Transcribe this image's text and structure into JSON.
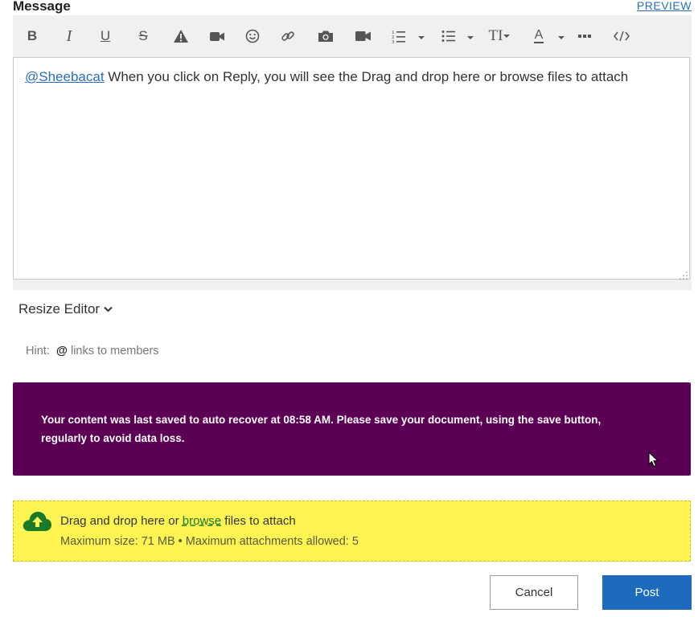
{
  "header": {
    "title": "Message",
    "preview_label": "PREVIEW"
  },
  "toolbar": {
    "buttons": [
      {
        "name": "bold",
        "glyph": "B"
      },
      {
        "name": "italic",
        "glyph": "I"
      },
      {
        "name": "underline",
        "glyph": "U"
      },
      {
        "name": "strikethrough",
        "glyph": "S"
      },
      {
        "name": "spoiler",
        "icon": "warning-icon"
      },
      {
        "name": "video",
        "icon": "video-icon"
      },
      {
        "name": "emoji",
        "icon": "smiley-icon"
      },
      {
        "name": "link",
        "icon": "link-icon"
      },
      {
        "name": "photo",
        "icon": "camera-icon"
      },
      {
        "name": "video-embed",
        "icon": "video-icon"
      },
      {
        "name": "numbered-list",
        "icon": "ordered-list-icon"
      },
      {
        "name": "bulleted-list",
        "icon": "bullet-list-icon"
      },
      {
        "name": "font-size",
        "glyph": "TI"
      },
      {
        "name": "font-color",
        "glyph": "A"
      },
      {
        "name": "more",
        "icon": "more-icon"
      },
      {
        "name": "source-code",
        "icon": "code-icon"
      }
    ]
  },
  "editor": {
    "mention": "@Sheebacat",
    "body": " When you click on Reply, you will see the Drag and drop here or browse files to attach"
  },
  "resize_editor_label": "Resize Editor",
  "hint": {
    "label": "Hint:",
    "symbol": "@",
    "text": "links to members"
  },
  "autosave_banner": {
    "text": "Your content was last saved to auto recover at 08:58 AM. Please save your document, using the save button, regularly to avoid data loss."
  },
  "dropzone": {
    "prefix": "Drag and drop here or ",
    "browse_label": "browse",
    "suffix": " files to attach",
    "limits": "Maximum size: 71 MB • Maximum attachments allowed: 5",
    "icon": "cloud-upload-icon"
  },
  "actions": {
    "cancel_label": "Cancel",
    "post_label": "Post"
  },
  "colors": {
    "banner_bg": "#5c0056",
    "dropzone_bg": "#fff552",
    "post_button_bg": "#1e6bbd",
    "link": "#2a6ebb",
    "upload_icon": "#1a7a2a"
  }
}
